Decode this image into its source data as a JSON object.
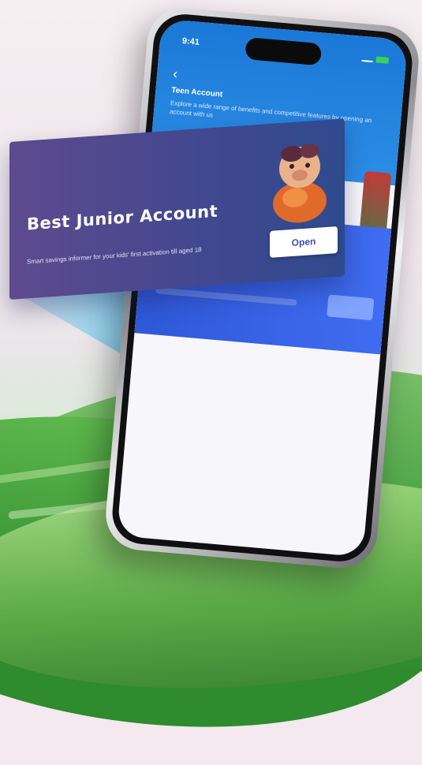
{
  "phone": {
    "status_time": "9:41",
    "header_title": "Teen Account",
    "header_text": "Explore a wide range of benefits and competitive features by opening an account with us"
  },
  "promo": {
    "title": "Best Junior Account",
    "subtitle": "Smart savings informer for your kids' first activation till aged 18",
    "button_label": "Open"
  },
  "colors": {
    "promo_left": "#5e4a8e",
    "promo_right": "#2f4a8e",
    "header_blue": "#1a78d6",
    "accent_green": "#39d353"
  },
  "icons": {
    "back": "chevron-left-icon",
    "mascot": "piggy-character-icon"
  }
}
